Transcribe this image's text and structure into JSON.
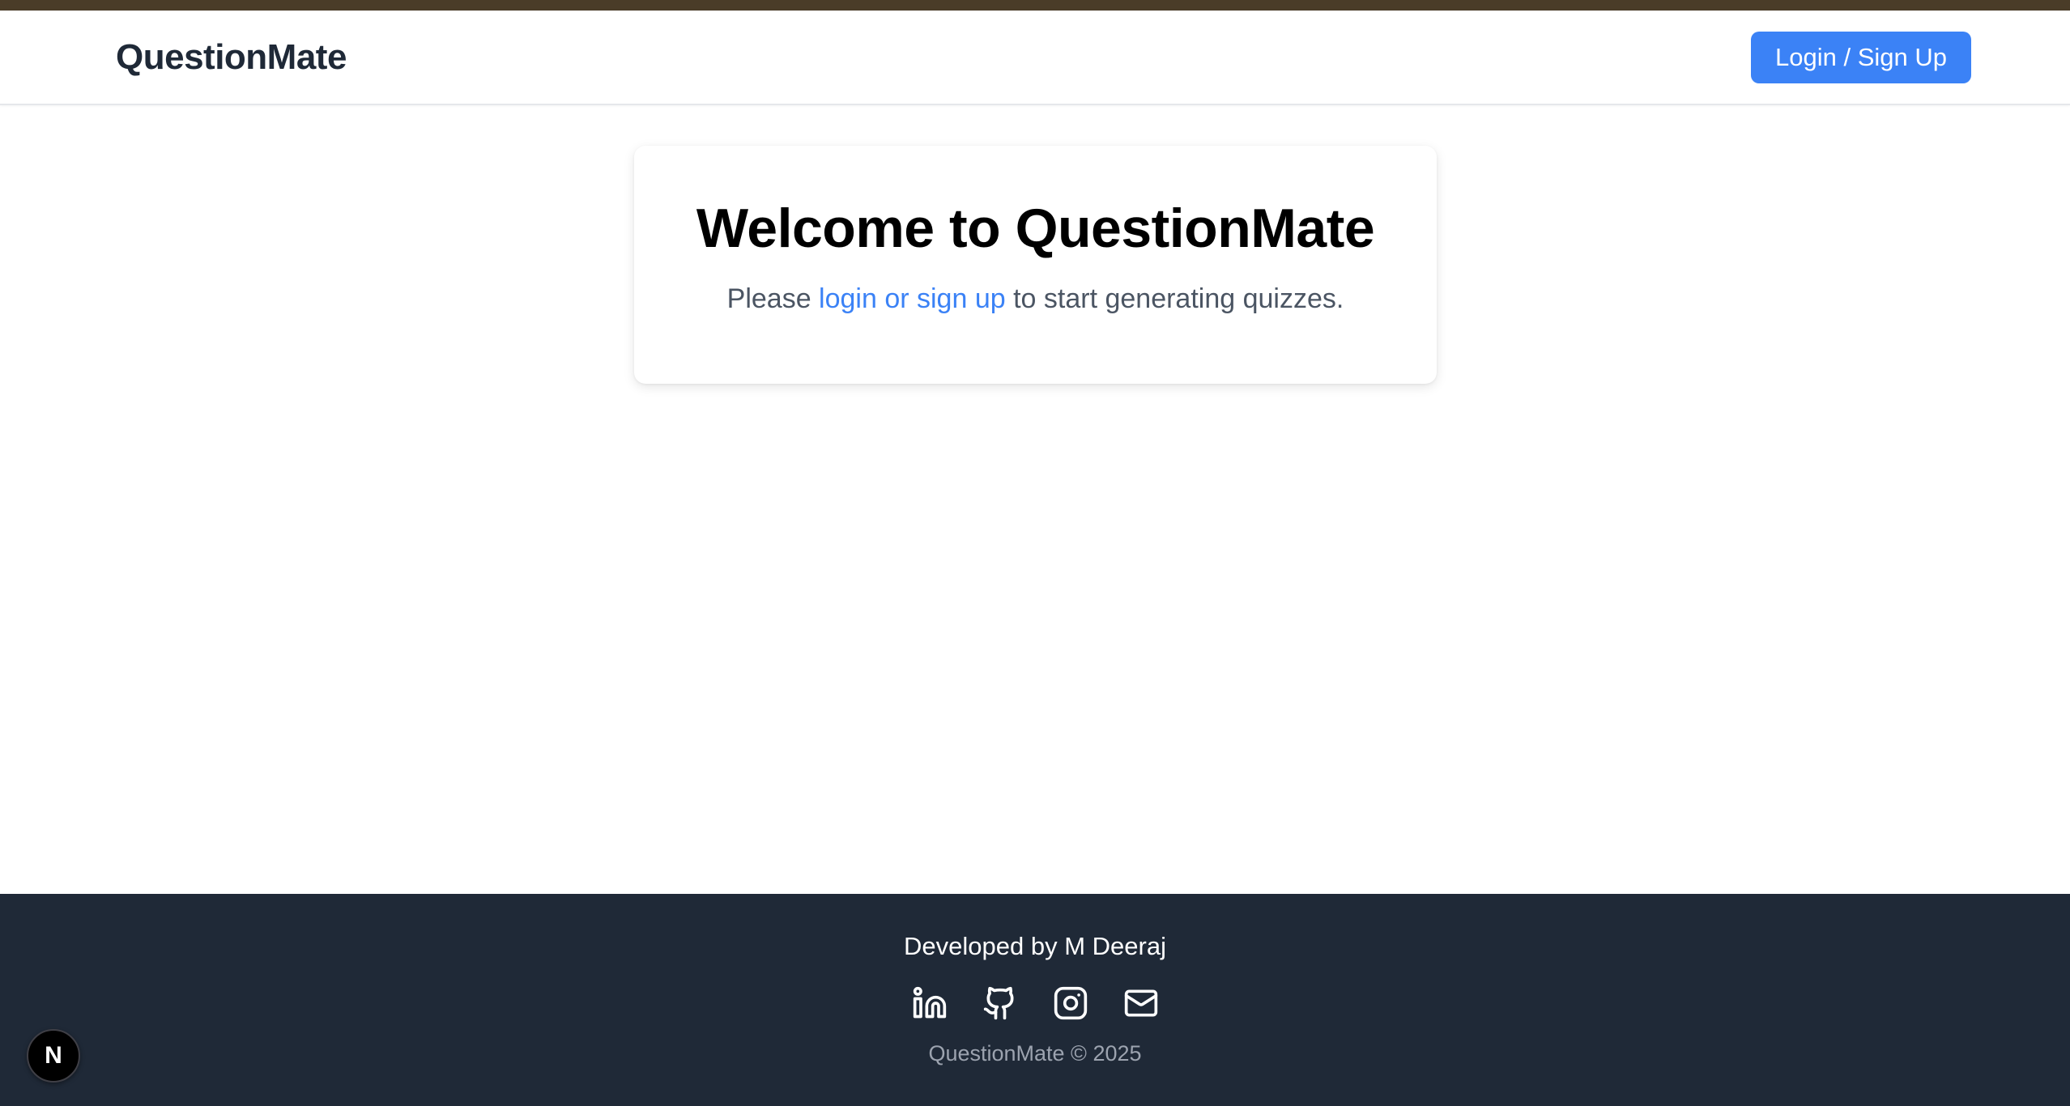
{
  "navbar": {
    "brand": "QuestionMate",
    "login_label": "Login / Sign Up"
  },
  "welcome": {
    "title": "Welcome to QuestionMate",
    "text_before": "Please ",
    "link_text": "login or sign up",
    "text_after": " to start generating quizzes."
  },
  "footer": {
    "credit": "Developed by M Deeraj",
    "social_icons": [
      "linkedin-icon",
      "github-icon",
      "instagram-icon",
      "mail-icon"
    ],
    "copyright": "QuestionMate © 2025"
  },
  "dev_badge": {
    "label": "N"
  },
  "colors": {
    "accent": "#3b82f6",
    "footer_bg": "#1f2937",
    "top_strip": "#4a3c28",
    "brand_text": "#1f2937"
  }
}
